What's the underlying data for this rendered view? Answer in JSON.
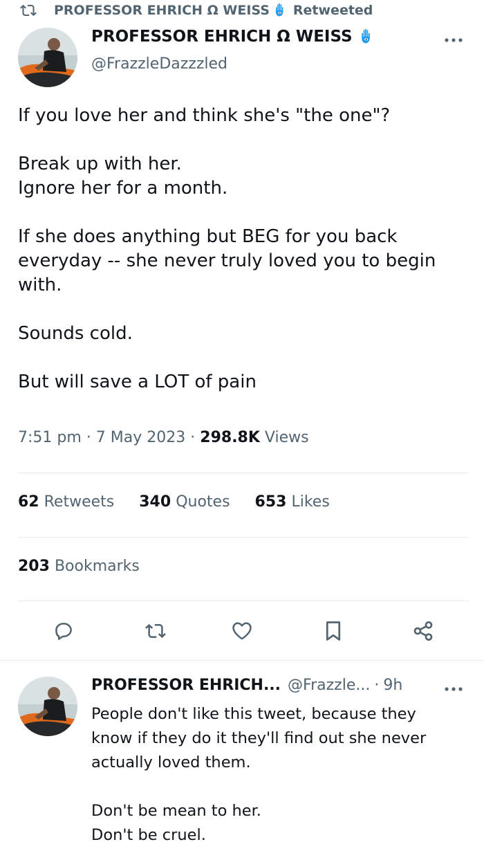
{
  "retweet_bar": {
    "name": "PROFESSOR EHRICH Ω WEISS",
    "status": "Retweeted",
    "icon": "retweet-icon"
  },
  "tweet": {
    "author_name": "PROFESSOR EHRICH Ω WEISS",
    "author_handle": "@FrazzleDazzzled",
    "badge_icon": "hamsa-icon",
    "body": [
      "If you love her and think she's \"the one\"?",
      "Break up with her.\nIgnore her for a month.",
      "If she does anything but BEG for you back everyday -- she never truly loved you to begin with.",
      "Sounds cold.",
      "But will save a LOT of pain"
    ],
    "time": "7:51 pm",
    "date": "7 May 2023",
    "views_count": "298.8K",
    "views_label": "Views",
    "separator": "·",
    "stats": {
      "retweets_count": "62",
      "retweets_label": "Retweets",
      "quotes_count": "340",
      "quotes_label": "Quotes",
      "likes_count": "653",
      "likes_label": "Likes",
      "bookmarks_count": "203",
      "bookmarks_label": "Bookmarks"
    },
    "actions": [
      "reply-icon",
      "retweet-icon",
      "like-icon",
      "bookmark-icon",
      "share-icon"
    ]
  },
  "reply": {
    "author_name": "PROFESSOR EHRICH...",
    "author_handle": "@Frazzle...",
    "separator": "·",
    "time": "9h",
    "body": [
      "People don't like this tweet, because they know if they do it they'll find out she never actually loved them.",
      "Don't be mean to her.\nDon't be cruel."
    ]
  },
  "colors": {
    "text": "#0f1419",
    "secondary": "#536471",
    "divider": "#e6ecf0",
    "verified_badge": "#1d9bf0"
  }
}
